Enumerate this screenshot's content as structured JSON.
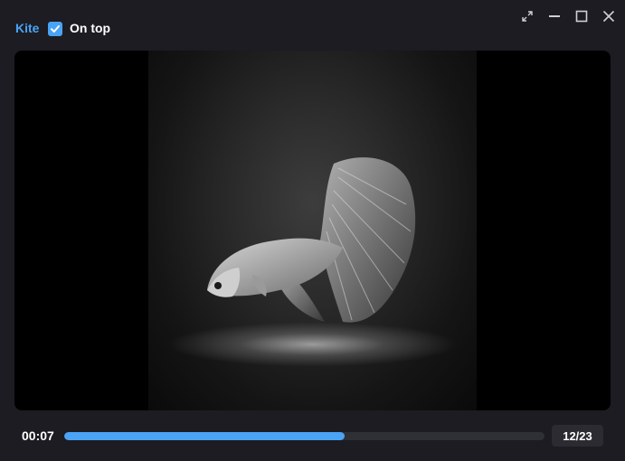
{
  "header": {
    "app_name": "Kite",
    "on_top_label": "On top",
    "on_top_checked": true
  },
  "window_controls": {
    "icons": [
      "fullscreen-icon",
      "minimize-icon",
      "maximize-icon",
      "close-icon"
    ]
  },
  "player": {
    "current_time": "00:07",
    "progress": 0.583,
    "counter": "12/23"
  },
  "colors": {
    "accent": "#4aa3f4",
    "background": "#1c1c22",
    "track": "#2f2f36",
    "counter_bg": "#2b2b31"
  }
}
